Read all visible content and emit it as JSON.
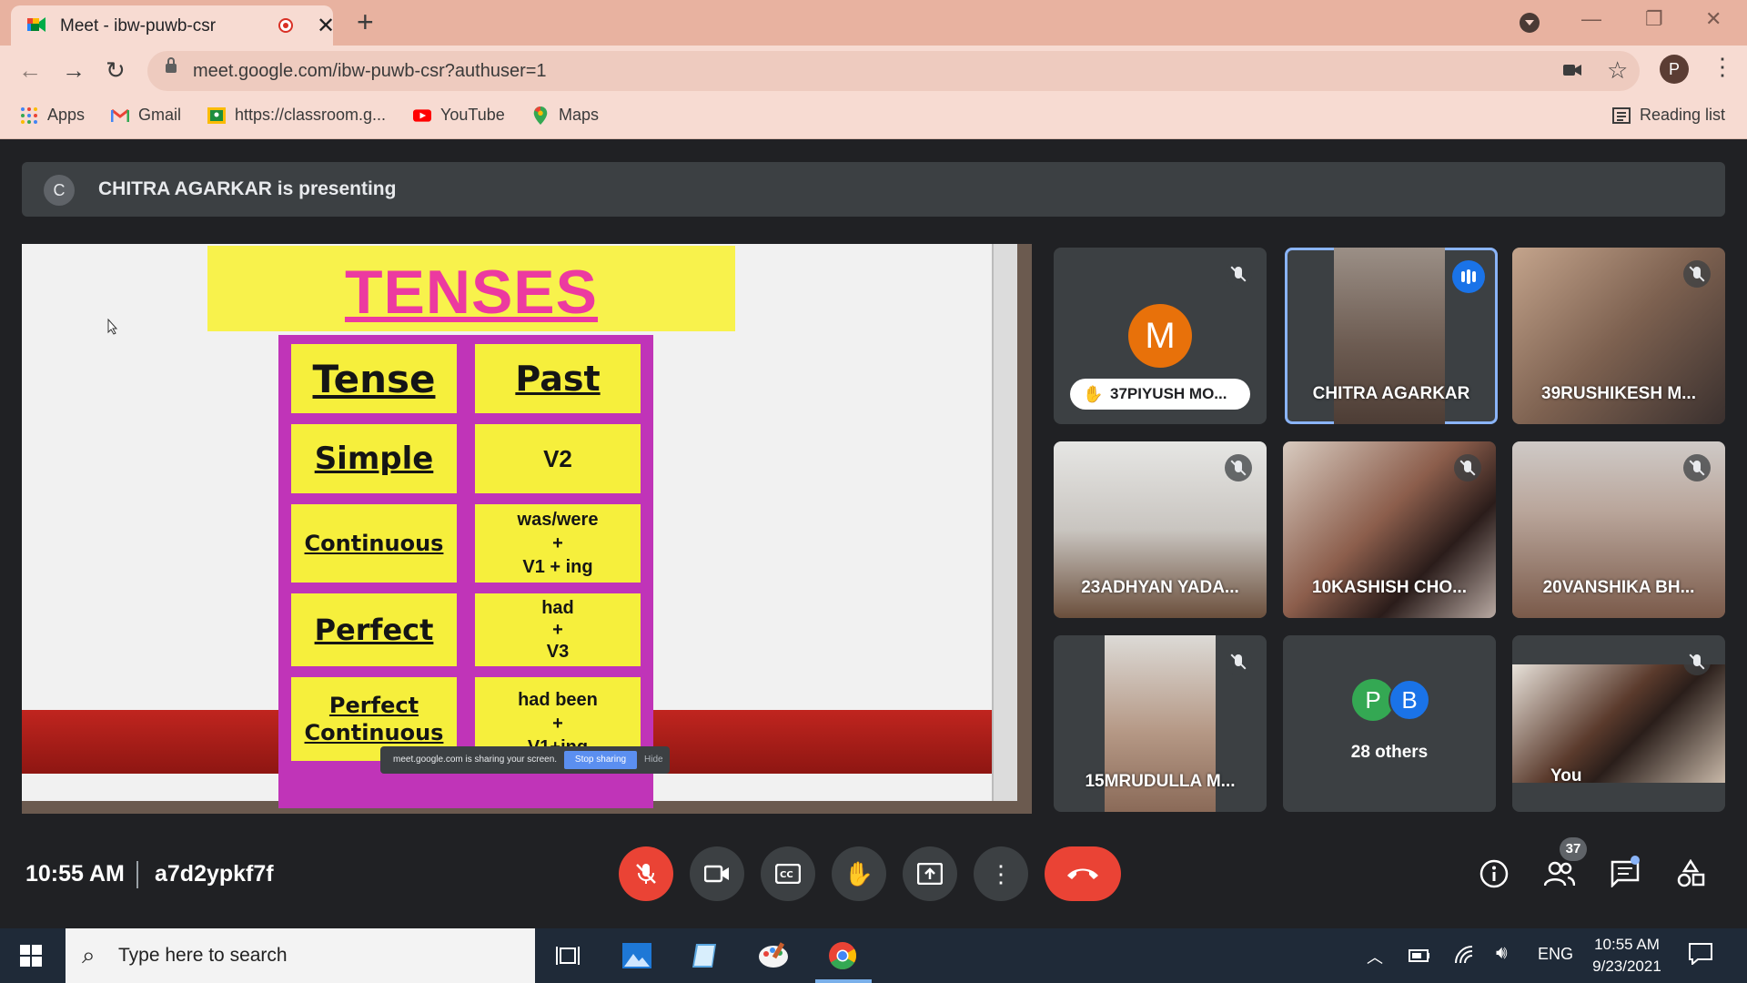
{
  "browser": {
    "tab_title": "Meet - ibw-puwb-csr",
    "tab_close": "✕",
    "new_tab": "+",
    "url": "meet.google.com/ibw-puwb-csr?authuser=1",
    "profile_initial": "P",
    "bookmarks": [
      "Apps",
      "Gmail",
      "https://classroom.g...",
      "YouTube",
      "Maps"
    ],
    "reading_list": "Reading list"
  },
  "meet": {
    "presenter_initial": "C",
    "presenting_text": "CHITRA AGARKAR is presenting",
    "slide": {
      "title": "TENSES",
      "rows": [
        [
          "Tense",
          "Past"
        ],
        [
          "Simple",
          "V2"
        ],
        [
          "Continuous",
          "was/were\n+\nV1 + ing"
        ],
        [
          "Perfect",
          "had\n+\nV3"
        ],
        [
          "Perfect\nContinuous",
          "had been\n+\nV1+ing"
        ]
      ],
      "share_notice": "meet.google.com is sharing your screen.",
      "stop_sharing": "Stop sharing",
      "hide": "Hide"
    },
    "tiles": [
      {
        "name": "37PIYUSH MO...",
        "initial": "M",
        "avatar_color": "#e8710a",
        "muted": true,
        "hand_raised": true
      },
      {
        "name": "CHITRA AGARKAR",
        "speaking": true
      },
      {
        "name": "39RUSHIKESH M...",
        "muted": true
      },
      {
        "name": "23ADHYAN YADA...",
        "muted": true
      },
      {
        "name": "10KASHISH CHO...",
        "muted": true
      },
      {
        "name": "20VANSHIKA BH...",
        "muted": true
      },
      {
        "name": "15MRUDULLA M...",
        "muted": true
      },
      {
        "name": "28 others",
        "initials": [
          "P",
          "B"
        ],
        "colors": [
          "#34a853",
          "#1a73e8"
        ]
      },
      {
        "name": "You",
        "muted": true
      }
    ],
    "clock": "10:55 AM",
    "meeting_code": "a7d2ypkf7f",
    "participant_count": "37"
  },
  "taskbar": {
    "search_placeholder": "Type here to search",
    "language": "ENG",
    "time": "10:55 AM",
    "date": "9/23/2021"
  }
}
